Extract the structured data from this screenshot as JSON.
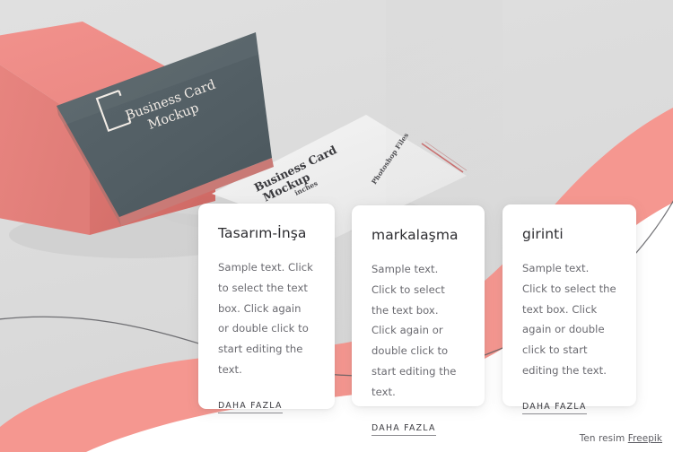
{
  "page": {
    "background_color": "#ffffff",
    "scene_background_color": "#dcdcdc"
  },
  "hero": {
    "name": "business-card-mockup-photo",
    "dark_card": {
      "line1": "Business Card",
      "line2": "Mockup",
      "color": "#556268",
      "logo": "bracket-square-logo"
    },
    "light_card": {
      "line1": "Business Card",
      "line2": "Mockup",
      "label_left": "inches",
      "label_right": "Photoshop Files",
      "color": "#efefef",
      "accent_color": "#c96c6c"
    },
    "cube": {
      "name": "coral-cube",
      "top_color": "#ef8b86",
      "front_color": "#e98884",
      "side_color": "#d9746f"
    }
  },
  "decor": {
    "wave_color": "#f59790",
    "line_color": "#5c5c60"
  },
  "cards": [
    {
      "title": "Tasarım-İnşa",
      "body": "Sample text. Click to select the text box. Click again or double click to start editing the text.",
      "link": "DAHA FAZLA"
    },
    {
      "title": "markalaşma",
      "body": "Sample text. Click to select the text box. Click again or double click to start editing the text.",
      "link": "DAHA FAZLA"
    },
    {
      "title": "girinti",
      "body": "Sample text. Click to select the text box. Click again or double click to start editing the text.",
      "link": "DAHA FAZLA"
    }
  ],
  "footer": {
    "credit_prefix": "Ten resim",
    "credit_link": "Freepik"
  }
}
